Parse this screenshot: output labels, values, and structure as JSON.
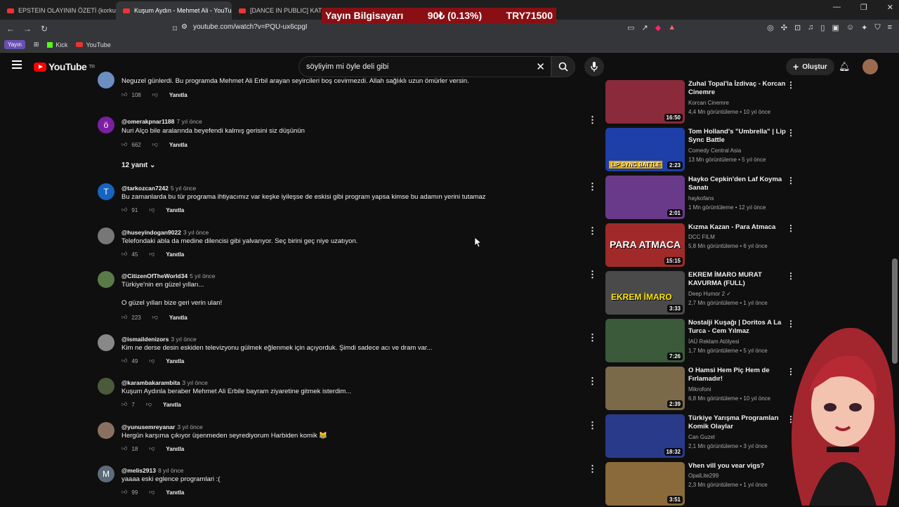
{
  "browser": {
    "tabs": [
      {
        "title": "EPSTEIN OLAYININ ÖZETİ (korkunç)"
      },
      {
        "title": "Kuşum Aydın - Mehmet Ali - YouTube"
      },
      {
        "title": "[DANCE IN PUBLIC] KATSEYE"
      }
    ],
    "url": "youtube.com/watch?v=PQU-ux6cpgI",
    "bookmarks": [
      {
        "label": "Yayın"
      },
      {
        "label": "Kick"
      },
      {
        "label": "YouTube"
      }
    ]
  },
  "overlay": {
    "label": "Yayın Bilgisayarı",
    "change": "90₺ (0.13%)",
    "value": "TRY71500"
  },
  "header": {
    "logo": "YouTube",
    "logo_region": "TR",
    "search_value": "söyliyim mi öyle deli gibi",
    "create_label": "Oluştur"
  },
  "comments": [
    {
      "author": "",
      "time": "",
      "text": "Neguzel  günlerdi. Bu programda Mehmet Ali Erbil arayan seyircileri boş cevirmezdi. Allah sağlıklı uzun ömürler versin.",
      "likes": "108",
      "reply": "Yanıtla",
      "avatar_letter": "",
      "avatar_color": "#6a8fc0"
    },
    {
      "author": "@omerakpnar1188",
      "time": "7 yıl önce",
      "text": "Nuri Alço bile aralarında beyefendi kalmış gerisini siz düşünün",
      "likes": "662",
      "reply": "Yanıtla",
      "avatar_letter": "ö",
      "avatar_color": "#7b1fa2"
    },
    {
      "author": "@tarkozcan7242",
      "time": "5 yıl önce",
      "text": "Bu zamanlarda bu tür programa ihtiyacımız var keşke iyileşse de eskisi gibi program yapsa kimse bu adamın yerini tutamaz",
      "likes": "91",
      "reply": "Yanıtla",
      "avatar_letter": "T",
      "avatar_color": "#1565c0"
    },
    {
      "author": "@huseyindogan9022",
      "time": "3 yıl önce",
      "text": "Telefondaki abla da medine dilencisi gibi yalvarıyor. Seç birini geç niye uzatıyon.",
      "likes": "45",
      "reply": "Yanıtla",
      "avatar_letter": "",
      "avatar_color": "#777"
    },
    {
      "author": "@CitizenOfTheWorld34",
      "time": "5 yıl önce",
      "text": "Türkiye'nin en güzel yılları...",
      "text2": "O güzel yılları bize geri verin ulan!",
      "likes": "223",
      "reply": "Yanıtla",
      "avatar_letter": "",
      "avatar_color": "#5a7a4a"
    },
    {
      "author": "@ismaildenizors",
      "time": "3 yıl önce",
      "text": "Kim ne derse desin eskiden televizyonu gülmek eğlenmek için açıyorduk. Şimdi sadece acı ve dram var...",
      "likes": "49",
      "reply": "Yanıtla",
      "avatar_letter": "",
      "avatar_color": "#888"
    },
    {
      "author": "@karambakarambita",
      "time": "3 yıl önce",
      "text": "Kuşum Aydınla beraber Mehmet Ali Erbile bayram ziyaretine gitmek isterdim...",
      "likes": "7",
      "reply": "Yanıtla",
      "avatar_letter": "",
      "avatar_color": "#4a5a3a"
    },
    {
      "author": "@yunusemreyanar",
      "time": "3 yıl önce",
      "text": "Hergün karşıma çıkıyor üşenmeden seyrediyorum Harbiden komik 😹",
      "likes": "18",
      "reply": "Yanıtla",
      "avatar_letter": "",
      "avatar_color": "#8a7060"
    },
    {
      "author": "@melis2913",
      "time": "8 yıl önce",
      "text": "yaaaa eski eglence programlari :(",
      "likes": "99",
      "reply": "Yanıtla",
      "avatar_letter": "M",
      "avatar_color": "#5c6b7a"
    }
  ],
  "replies_toggle": "12 yanıt",
  "sidebar": [
    {
      "title": "Zuhal Topal'la İzdivaç - Korcan Cinemre",
      "channel": "Korcan Cinemre",
      "meta": "4,4 Mn görüntüleme • 10 yıl önce",
      "duration": "16:50",
      "thumb_color": "#8a2a3a",
      "thumb_text": ""
    },
    {
      "title": "Tom Holland's \"Umbrella\" | Lip Sync Battle",
      "channel": "Comedy Central Asia",
      "meta": "13 Mn görüntüleme • 5 yıl önce",
      "duration": "2:23",
      "thumb_color": "#1e3fa8",
      "thumb_text": "LIP SYNC BATTLE"
    },
    {
      "title": "Hayko Cepkin'den Laf Koyma Sanatı",
      "channel": "haykofans",
      "meta": "1 Mn görüntüleme • 12 yıl önce",
      "duration": "2:01",
      "thumb_color": "#6a3a8a",
      "thumb_text": ""
    },
    {
      "title": "Kızma Kazan - Para Atmaca",
      "channel": "DCC FILM",
      "meta": "5,8 Mn görüntüleme • 6 yıl önce",
      "duration": "15:15",
      "thumb_color": "#a02a2a",
      "thumb_text": "PARA ATMACA"
    },
    {
      "title": "EKREM İMARO MURAT KAVURMA (FULL)",
      "channel": "Deep Humor 2",
      "meta": "2,7 Mn görüntüleme • 1 yıl önce",
      "duration": "3:33",
      "thumb_color": "#4a4a4a",
      "thumb_text": "EKREM İMARO"
    },
    {
      "title": "Nostalji Kuşağı | Doritos A La Turca - Cem Yılmaz",
      "channel": "İAÜ Reklam Atölyesi",
      "meta": "1,7 Mn görüntüleme • 5 yıl önce",
      "duration": "7:26",
      "thumb_color": "#3a5a3a",
      "thumb_text": ""
    },
    {
      "title": "O Hamsi Hem Piç Hem de Fırlamadır!",
      "channel": "Mikrofoni",
      "meta": "6,8 Mn görüntüleme • 10 yıl önce",
      "duration": "2:39",
      "thumb_color": "#7a6a4a",
      "thumb_text": ""
    },
    {
      "title": "Türkiye Yarışma Programları Komik Olaylar",
      "channel": "Can Guzel",
      "meta": "2,1 Mn görüntüleme • 3 yıl önce",
      "duration": "18:32",
      "thumb_color": "#2a3a8a",
      "thumb_text": ""
    },
    {
      "title": "Vhen vill you vear vigs?",
      "channel": "OpalLite299",
      "meta": "2,3 Mn görüntüleme • 1 yıl önce",
      "duration": "3:51",
      "thumb_color": "#8a6a3a",
      "thumb_text": ""
    }
  ]
}
